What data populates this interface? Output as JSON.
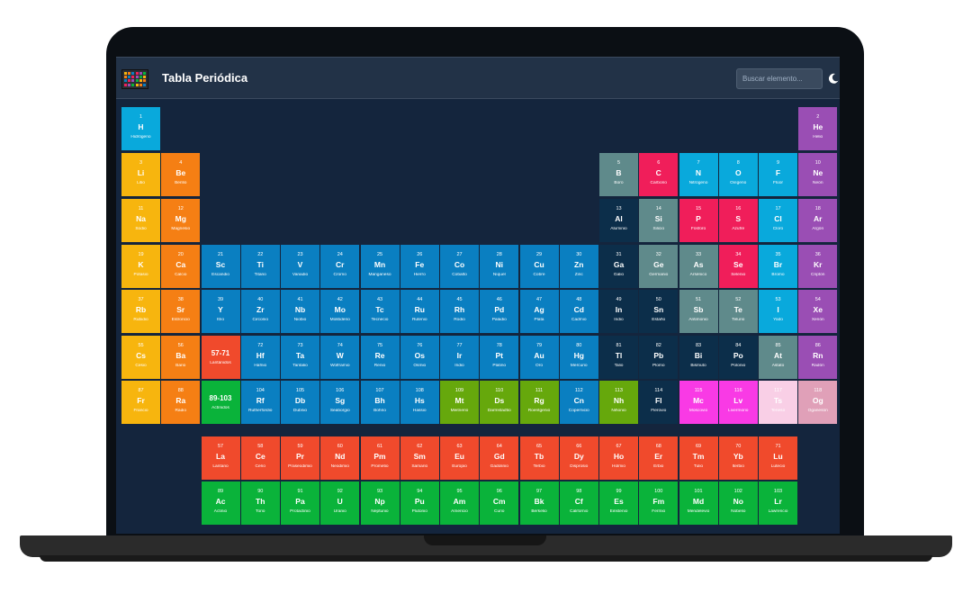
{
  "app": {
    "title": "Tabla Periódica"
  },
  "search": {
    "placeholder": "Buscar elemento..."
  },
  "icons": {
    "logo": "periodic-table-logo-icon",
    "theme": "moon-icon"
  },
  "colors": {
    "screen_bg": "#14253d",
    "topbar_bg": "#223247",
    "alkali": "#f7b50e",
    "alkaline": "#f57f14",
    "transition": "#0a7fc1",
    "post_transition": "#0c2e4a",
    "metalloid": "#5f8a8b",
    "nonmetal": "#f01e5a",
    "halogen": "#09a9dc",
    "noble": "#9a4eb4",
    "lanthanide": "#f04a2c",
    "actinide": "#0ab33a",
    "unknown": "#66a80c",
    "hydrogen": "#09a9dc",
    "magenta": "#f93ae5",
    "light_pink": "#f9cfe6",
    "pink": "#e0a0b8"
  },
  "elements": [
    {
      "n": "1",
      "s": "H",
      "name": "Hidrógeno",
      "c": "halogen",
      "r": 1,
      "g": 1
    },
    {
      "n": "2",
      "s": "He",
      "name": "Helio",
      "c": "noble",
      "r": 1,
      "g": 18
    },
    {
      "n": "3",
      "s": "Li",
      "name": "Litio",
      "c": "alkali",
      "r": 2,
      "g": 1
    },
    {
      "n": "4",
      "s": "Be",
      "name": "Berilio",
      "c": "alkaline",
      "r": 2,
      "g": 2
    },
    {
      "n": "5",
      "s": "B",
      "name": "Boro",
      "c": "metalloid",
      "r": 2,
      "g": 13
    },
    {
      "n": "6",
      "s": "C",
      "name": "Carbono",
      "c": "nonmetal",
      "r": 2,
      "g": 14
    },
    {
      "n": "7",
      "s": "N",
      "name": "Nitrógeno",
      "c": "halogen",
      "r": 2,
      "g": 15
    },
    {
      "n": "8",
      "s": "O",
      "name": "Oxígeno",
      "c": "halogen",
      "r": 2,
      "g": 16
    },
    {
      "n": "9",
      "s": "F",
      "name": "Flúor",
      "c": "halogen",
      "r": 2,
      "g": 17
    },
    {
      "n": "10",
      "s": "Ne",
      "name": "Neón",
      "c": "noble",
      "r": 2,
      "g": 18
    },
    {
      "n": "11",
      "s": "Na",
      "name": "Sodio",
      "c": "alkali",
      "r": 3,
      "g": 1
    },
    {
      "n": "12",
      "s": "Mg",
      "name": "Magnesio",
      "c": "alkaline",
      "r": 3,
      "g": 2
    },
    {
      "n": "13",
      "s": "Al",
      "name": "Aluminio",
      "c": "post_transition",
      "r": 3,
      "g": 13
    },
    {
      "n": "14",
      "s": "Si",
      "name": "Silicio",
      "c": "metalloid",
      "r": 3,
      "g": 14
    },
    {
      "n": "15",
      "s": "P",
      "name": "Fósforo",
      "c": "nonmetal",
      "r": 3,
      "g": 15
    },
    {
      "n": "16",
      "s": "S",
      "name": "Azufre",
      "c": "nonmetal",
      "r": 3,
      "g": 16
    },
    {
      "n": "17",
      "s": "Cl",
      "name": "Cloro",
      "c": "halogen",
      "r": 3,
      "g": 17
    },
    {
      "n": "18",
      "s": "Ar",
      "name": "Argón",
      "c": "noble",
      "r": 3,
      "g": 18
    },
    {
      "n": "19",
      "s": "K",
      "name": "Potasio",
      "c": "alkali",
      "r": 4,
      "g": 1
    },
    {
      "n": "20",
      "s": "Ca",
      "name": "Calcio",
      "c": "alkaline",
      "r": 4,
      "g": 2
    },
    {
      "n": "21",
      "s": "Sc",
      "name": "Escandio",
      "c": "transition",
      "r": 4,
      "g": 3
    },
    {
      "n": "22",
      "s": "Ti",
      "name": "Titano",
      "c": "transition",
      "r": 4,
      "g": 4
    },
    {
      "n": "23",
      "s": "V",
      "name": "Vanadio",
      "c": "transition",
      "r": 4,
      "g": 5
    },
    {
      "n": "24",
      "s": "Cr",
      "name": "Cromo",
      "c": "transition",
      "r": 4,
      "g": 6
    },
    {
      "n": "25",
      "s": "Mn",
      "name": "Manganeso",
      "c": "transition",
      "r": 4,
      "g": 7
    },
    {
      "n": "26",
      "s": "Fe",
      "name": "Hierro",
      "c": "transition",
      "r": 4,
      "g": 8
    },
    {
      "n": "27",
      "s": "Co",
      "name": "Cobalto",
      "c": "transition",
      "r": 4,
      "g": 9
    },
    {
      "n": "28",
      "s": "Ni",
      "name": "Níquel",
      "c": "transition",
      "r": 4,
      "g": 10
    },
    {
      "n": "29",
      "s": "Cu",
      "name": "Cobre",
      "c": "transition",
      "r": 4,
      "g": 11
    },
    {
      "n": "30",
      "s": "Zn",
      "name": "Zinc",
      "c": "transition",
      "r": 4,
      "g": 12
    },
    {
      "n": "31",
      "s": "Ga",
      "name": "Galio",
      "c": "post_transition",
      "r": 4,
      "g": 13
    },
    {
      "n": "32",
      "s": "Ge",
      "name": "Germanio",
      "c": "metalloid",
      "r": 4,
      "g": 14
    },
    {
      "n": "33",
      "s": "As",
      "name": "Arsénico",
      "c": "metalloid",
      "r": 4,
      "g": 15
    },
    {
      "n": "34",
      "s": "Se",
      "name": "Selenio",
      "c": "nonmetal",
      "r": 4,
      "g": 16
    },
    {
      "n": "35",
      "s": "Br",
      "name": "Bromo",
      "c": "halogen",
      "r": 4,
      "g": 17
    },
    {
      "n": "36",
      "s": "Kr",
      "name": "Criptón",
      "c": "noble",
      "r": 4,
      "g": 18
    },
    {
      "n": "37",
      "s": "Rb",
      "name": "Rubidio",
      "c": "alkali",
      "r": 5,
      "g": 1
    },
    {
      "n": "38",
      "s": "Sr",
      "name": "Estroncio",
      "c": "alkaline",
      "r": 5,
      "g": 2
    },
    {
      "n": "39",
      "s": "Y",
      "name": "Itrio",
      "c": "transition",
      "r": 5,
      "g": 3
    },
    {
      "n": "40",
      "s": "Zr",
      "name": "Circonio",
      "c": "transition",
      "r": 5,
      "g": 4
    },
    {
      "n": "41",
      "s": "Nb",
      "name": "Niobio",
      "c": "transition",
      "r": 5,
      "g": 5
    },
    {
      "n": "42",
      "s": "Mo",
      "name": "Molibdeno",
      "c": "transition",
      "r": 5,
      "g": 6
    },
    {
      "n": "43",
      "s": "Tc",
      "name": "Tecnecio",
      "c": "transition",
      "r": 5,
      "g": 7
    },
    {
      "n": "44",
      "s": "Ru",
      "name": "Rutenio",
      "c": "transition",
      "r": 5,
      "g": 8
    },
    {
      "n": "45",
      "s": "Rh",
      "name": "Rodio",
      "c": "transition",
      "r": 5,
      "g": 9
    },
    {
      "n": "46",
      "s": "Pd",
      "name": "Paladio",
      "c": "transition",
      "r": 5,
      "g": 10
    },
    {
      "n": "47",
      "s": "Ag",
      "name": "Plata",
      "c": "transition",
      "r": 5,
      "g": 11
    },
    {
      "n": "48",
      "s": "Cd",
      "name": "Cadmio",
      "c": "transition",
      "r": 5,
      "g": 12
    },
    {
      "n": "49",
      "s": "In",
      "name": "Indio",
      "c": "post_transition",
      "r": 5,
      "g": 13
    },
    {
      "n": "50",
      "s": "Sn",
      "name": "Estaño",
      "c": "post_transition",
      "r": 5,
      "g": 14
    },
    {
      "n": "51",
      "s": "Sb",
      "name": "Antimonio",
      "c": "metalloid",
      "r": 5,
      "g": 15
    },
    {
      "n": "52",
      "s": "Te",
      "name": "Telurio",
      "c": "metalloid",
      "r": 5,
      "g": 16
    },
    {
      "n": "53",
      "s": "I",
      "name": "Yodo",
      "c": "halogen",
      "r": 5,
      "g": 17
    },
    {
      "n": "54",
      "s": "Xe",
      "name": "Xenón",
      "c": "noble",
      "r": 5,
      "g": 18
    },
    {
      "n": "55",
      "s": "Cs",
      "name": "Cesio",
      "c": "alkali",
      "r": 6,
      "g": 1
    },
    {
      "n": "56",
      "s": "Ba",
      "name": "Bario",
      "c": "alkaline",
      "r": 6,
      "g": 2
    },
    {
      "n": "",
      "s": "57-71",
      "name": "Lantánidos",
      "c": "lanthanide",
      "r": 6,
      "g": 3,
      "ph": true
    },
    {
      "n": "72",
      "s": "Hf",
      "name": "Hafnio",
      "c": "transition",
      "r": 6,
      "g": 4
    },
    {
      "n": "73",
      "s": "Ta",
      "name": "Tantalio",
      "c": "transition",
      "r": 6,
      "g": 5
    },
    {
      "n": "74",
      "s": "W",
      "name": "Wolframio",
      "c": "transition",
      "r": 6,
      "g": 6
    },
    {
      "n": "75",
      "s": "Re",
      "name": "Renio",
      "c": "transition",
      "r": 6,
      "g": 7
    },
    {
      "n": "76",
      "s": "Os",
      "name": "Osmio",
      "c": "transition",
      "r": 6,
      "g": 8
    },
    {
      "n": "77",
      "s": "Ir",
      "name": "Iridio",
      "c": "transition",
      "r": 6,
      "g": 9
    },
    {
      "n": "78",
      "s": "Pt",
      "name": "Platino",
      "c": "transition",
      "r": 6,
      "g": 10
    },
    {
      "n": "79",
      "s": "Au",
      "name": "Oro",
      "c": "transition",
      "r": 6,
      "g": 11
    },
    {
      "n": "80",
      "s": "Hg",
      "name": "Mercurio",
      "c": "transition",
      "r": 6,
      "g": 12
    },
    {
      "n": "81",
      "s": "Tl",
      "name": "Talio",
      "c": "post_transition",
      "r": 6,
      "g": 13
    },
    {
      "n": "82",
      "s": "Pb",
      "name": "Plomo",
      "c": "post_transition",
      "r": 6,
      "g": 14
    },
    {
      "n": "83",
      "s": "Bi",
      "name": "Bismuto",
      "c": "post_transition",
      "r": 6,
      "g": 15
    },
    {
      "n": "84",
      "s": "Po",
      "name": "Polonio",
      "c": "post_transition",
      "r": 6,
      "g": 16
    },
    {
      "n": "85",
      "s": "At",
      "name": "Astato",
      "c": "metalloid",
      "r": 6,
      "g": 17
    },
    {
      "n": "86",
      "s": "Rn",
      "name": "Radón",
      "c": "noble",
      "r": 6,
      "g": 18
    },
    {
      "n": "87",
      "s": "Fr",
      "name": "Francio",
      "c": "alkali",
      "r": 7,
      "g": 1
    },
    {
      "n": "88",
      "s": "Ra",
      "name": "Radio",
      "c": "alkaline",
      "r": 7,
      "g": 2
    },
    {
      "n": "",
      "s": "89-103",
      "name": "Actínidos",
      "c": "actinide",
      "r": 7,
      "g": 3,
      "ph": true
    },
    {
      "n": "104",
      "s": "Rf",
      "name": "Rutherfordio",
      "c": "transition",
      "r": 7,
      "g": 4
    },
    {
      "n": "105",
      "s": "Db",
      "name": "Dubnio",
      "c": "transition",
      "r": 7,
      "g": 5
    },
    {
      "n": "106",
      "s": "Sg",
      "name": "Seaborgio",
      "c": "transition",
      "r": 7,
      "g": 6
    },
    {
      "n": "107",
      "s": "Bh",
      "name": "Bohrio",
      "c": "transition",
      "r": 7,
      "g": 7
    },
    {
      "n": "108",
      "s": "Hs",
      "name": "Hassio",
      "c": "transition",
      "r": 7,
      "g": 8
    },
    {
      "n": "109",
      "s": "Mt",
      "name": "Meitnerio",
      "c": "unknown",
      "r": 7,
      "g": 9
    },
    {
      "n": "110",
      "s": "Ds",
      "name": "Darmstadtio",
      "c": "unknown",
      "r": 7,
      "g": 10
    },
    {
      "n": "111",
      "s": "Rg",
      "name": "Roentgenio",
      "c": "unknown",
      "r": 7,
      "g": 11
    },
    {
      "n": "112",
      "s": "Cn",
      "name": "Copernicio",
      "c": "transition",
      "r": 7,
      "g": 12
    },
    {
      "n": "113",
      "s": "Nh",
      "name": "Nihonio",
      "c": "unknown",
      "r": 7,
      "g": 13
    },
    {
      "n": "114",
      "s": "Fl",
      "name": "Flerovio",
      "c": "post_transition",
      "r": 7,
      "g": 14
    },
    {
      "n": "115",
      "s": "Mc",
      "name": "Moscovio",
      "c": "magenta",
      "r": 7,
      "g": 15
    },
    {
      "n": "116",
      "s": "Lv",
      "name": "Livermorio",
      "c": "magenta",
      "r": 7,
      "g": 16
    },
    {
      "n": "117",
      "s": "Ts",
      "name": "Teneso",
      "c": "light_pink",
      "r": 7,
      "g": 17
    },
    {
      "n": "118",
      "s": "Og",
      "name": "Oganesón",
      "c": "pink",
      "r": 7,
      "g": 18
    },
    {
      "n": "57",
      "s": "La",
      "name": "Lantano",
      "c": "lanthanide",
      "r": 8,
      "g": 3
    },
    {
      "n": "58",
      "s": "Ce",
      "name": "Cerio",
      "c": "lanthanide",
      "r": 8,
      "g": 4
    },
    {
      "n": "59",
      "s": "Pr",
      "name": "Praseodimio",
      "c": "lanthanide",
      "r": 8,
      "g": 5
    },
    {
      "n": "60",
      "s": "Nd",
      "name": "Neodimio",
      "c": "lanthanide",
      "r": 8,
      "g": 6
    },
    {
      "n": "61",
      "s": "Pm",
      "name": "Prometio",
      "c": "lanthanide",
      "r": 8,
      "g": 7
    },
    {
      "n": "62",
      "s": "Sm",
      "name": "Samario",
      "c": "lanthanide",
      "r": 8,
      "g": 8
    },
    {
      "n": "63",
      "s": "Eu",
      "name": "Europio",
      "c": "lanthanide",
      "r": 8,
      "g": 9
    },
    {
      "n": "64",
      "s": "Gd",
      "name": "Gadolinio",
      "c": "lanthanide",
      "r": 8,
      "g": 10
    },
    {
      "n": "65",
      "s": "Tb",
      "name": "Terbio",
      "c": "lanthanide",
      "r": 8,
      "g": 11
    },
    {
      "n": "66",
      "s": "Dy",
      "name": "Disprosio",
      "c": "lanthanide",
      "r": 8,
      "g": 12
    },
    {
      "n": "67",
      "s": "Ho",
      "name": "Holmio",
      "c": "lanthanide",
      "r": 8,
      "g": 13
    },
    {
      "n": "68",
      "s": "Er",
      "name": "Erbio",
      "c": "lanthanide",
      "r": 8,
      "g": 14
    },
    {
      "n": "69",
      "s": "Tm",
      "name": "Tulio",
      "c": "lanthanide",
      "r": 8,
      "g": 15
    },
    {
      "n": "70",
      "s": "Yb",
      "name": "Iterbio",
      "c": "lanthanide",
      "r": 8,
      "g": 16
    },
    {
      "n": "71",
      "s": "Lu",
      "name": "Lutecio",
      "c": "lanthanide",
      "r": 8,
      "g": 17
    },
    {
      "n": "89",
      "s": "Ac",
      "name": "Actinio",
      "c": "actinide",
      "r": 9,
      "g": 3
    },
    {
      "n": "90",
      "s": "Th",
      "name": "Torio",
      "c": "actinide",
      "r": 9,
      "g": 4
    },
    {
      "n": "91",
      "s": "Pa",
      "name": "Protactinio",
      "c": "actinide",
      "r": 9,
      "g": 5
    },
    {
      "n": "92",
      "s": "U",
      "name": "Uranio",
      "c": "actinide",
      "r": 9,
      "g": 6
    },
    {
      "n": "93",
      "s": "Np",
      "name": "Neptunio",
      "c": "actinide",
      "r": 9,
      "g": 7
    },
    {
      "n": "94",
      "s": "Pu",
      "name": "Plutonio",
      "c": "actinide",
      "r": 9,
      "g": 8
    },
    {
      "n": "95",
      "s": "Am",
      "name": "Americio",
      "c": "actinide",
      "r": 9,
      "g": 9
    },
    {
      "n": "96",
      "s": "Cm",
      "name": "Curio",
      "c": "actinide",
      "r": 9,
      "g": 10
    },
    {
      "n": "97",
      "s": "Bk",
      "name": "Berkelio",
      "c": "actinide",
      "r": 9,
      "g": 11
    },
    {
      "n": "98",
      "s": "Cf",
      "name": "Californio",
      "c": "actinide",
      "r": 9,
      "g": 12
    },
    {
      "n": "99",
      "s": "Es",
      "name": "Einstenio",
      "c": "actinide",
      "r": 9,
      "g": 13
    },
    {
      "n": "100",
      "s": "Fm",
      "name": "Fermio",
      "c": "actinide",
      "r": 9,
      "g": 14
    },
    {
      "n": "101",
      "s": "Md",
      "name": "Mendelevio",
      "c": "actinide",
      "r": 9,
      "g": 15
    },
    {
      "n": "102",
      "s": "No",
      "name": "Nobelio",
      "c": "actinide",
      "r": 9,
      "g": 16
    },
    {
      "n": "103",
      "s": "Lr",
      "name": "Lawrencio",
      "c": "actinide",
      "r": 9,
      "g": 17
    }
  ]
}
